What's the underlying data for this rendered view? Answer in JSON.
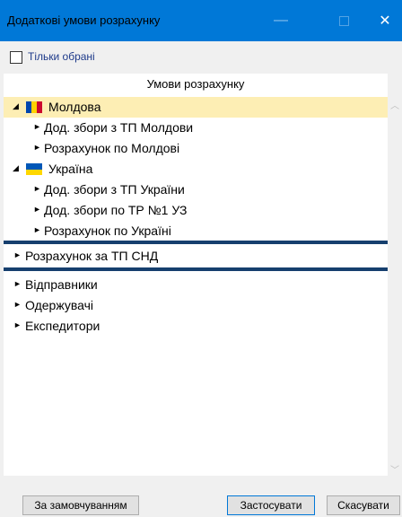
{
  "window": {
    "title": "Додаткові умови розрахунку",
    "min_glyph": "—",
    "close_glyph": "✕"
  },
  "filter": {
    "only_selected_label": "Тільки обрані",
    "checked": false
  },
  "grid": {
    "header": "Умови розрахунку"
  },
  "tree": {
    "moldova": {
      "label": "Молдова",
      "children": [
        "Дод. збори з ТП Молдови",
        "Розрахунок по Молдові"
      ]
    },
    "ukraine": {
      "label": "Україна",
      "children": [
        "Дод. збори з ТП України",
        "Дод. збори по ТР №1 УЗ",
        "Розрахунок по Україні"
      ]
    },
    "cis": "Розрахунок за ТП СНД",
    "senders": "Відправники",
    "receivers": "Одержувачі",
    "forwarders": "Експедитори"
  },
  "buttons": {
    "default": "За замовчуванням",
    "apply": "Застосувати",
    "cancel": "Скасувати"
  },
  "colors": {
    "titlebar": "#0078d7",
    "selected_row": "#fdeeb4",
    "divider": "#163f6e",
    "flag_md": [
      "#0046ae",
      "#ffd200",
      "#cc092f"
    ],
    "flag_ua": [
      "#0057b7",
      "#ffd700"
    ]
  }
}
